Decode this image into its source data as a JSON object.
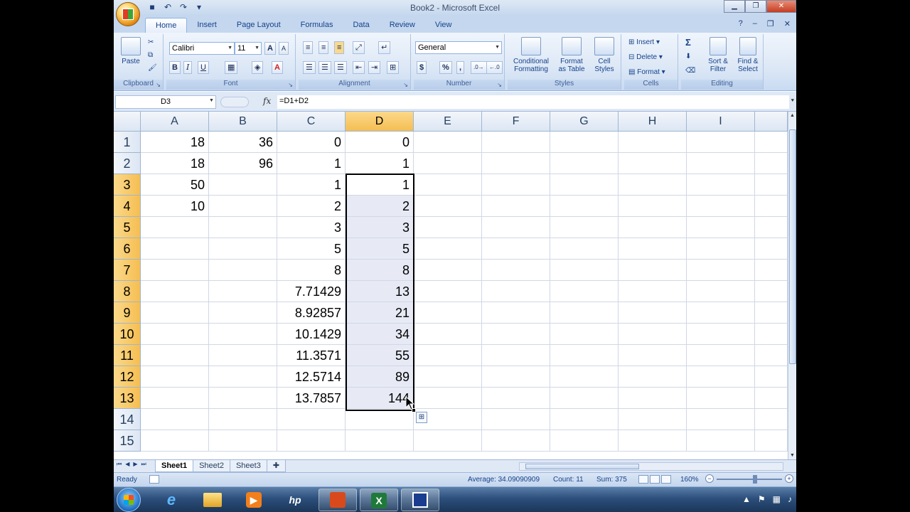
{
  "window": {
    "title": "Book2 - Microsoft Excel"
  },
  "tabs": [
    "Home",
    "Insert",
    "Page Layout",
    "Formulas",
    "Data",
    "Review",
    "View"
  ],
  "ribbon": {
    "clipboard": {
      "paste": "Paste",
      "label": "Clipboard"
    },
    "font": {
      "name": "Calibri",
      "size": "11",
      "grow": "A",
      "shrink": "A",
      "bold": "B",
      "italic": "I",
      "underline": "U",
      "label": "Font"
    },
    "alignment": {
      "label": "Alignment"
    },
    "number": {
      "format": "General",
      "currency": "$",
      "percent": "%",
      "comma": ",",
      "label": "Number"
    },
    "styles": {
      "conditional": "Conditional",
      "conditional2": "Formatting",
      "format_table": "Format",
      "format_table2": "as Table",
      "cell_styles": "Cell",
      "cell_styles2": "Styles",
      "label": "Styles"
    },
    "cells": {
      "insert": "Insert",
      "delete": "Delete",
      "format": "Format",
      "label": "Cells"
    },
    "editing": {
      "sigma": "Σ",
      "sort": "Sort &",
      "sort2": "Filter",
      "find": "Find &",
      "find2": "Select",
      "label": "Editing"
    }
  },
  "formula_bar": {
    "name_box": "D3",
    "fx": "fx",
    "formula": "=D1+D2"
  },
  "columns": [
    "A",
    "B",
    "C",
    "D",
    "E",
    "F",
    "G",
    "H",
    "I"
  ],
  "rows": [
    {
      "n": "1",
      "a": "18",
      "b": "36",
      "c": "0",
      "d": "0"
    },
    {
      "n": "2",
      "a": "18",
      "b": "96",
      "c": "1",
      "d": "1"
    },
    {
      "n": "3",
      "a": "50",
      "b": "",
      "c": "1",
      "d": "1"
    },
    {
      "n": "4",
      "a": "10",
      "b": "",
      "c": "2",
      "d": "2"
    },
    {
      "n": "5",
      "a": "",
      "b": "",
      "c": "3",
      "d": "3"
    },
    {
      "n": "6",
      "a": "",
      "b": "",
      "c": "5",
      "d": "5"
    },
    {
      "n": "7",
      "a": "",
      "b": "",
      "c": "8",
      "d": "8"
    },
    {
      "n": "8",
      "a": "",
      "b": "",
      "c": "7.71429",
      "d": "13"
    },
    {
      "n": "9",
      "a": "",
      "b": "",
      "c": "8.92857",
      "d": "21"
    },
    {
      "n": "10",
      "a": "",
      "b": "",
      "c": "10.1429",
      "d": "34"
    },
    {
      "n": "11",
      "a": "",
      "b": "",
      "c": "11.3571",
      "d": "55"
    },
    {
      "n": "12",
      "a": "",
      "b": "",
      "c": "12.5714",
      "d": "89"
    },
    {
      "n": "13",
      "a": "",
      "b": "",
      "c": "13.7857",
      "d": "144"
    },
    {
      "n": "14",
      "a": "",
      "b": "",
      "c": "",
      "d": ""
    },
    {
      "n": "15",
      "a": "",
      "b": "",
      "c": "",
      "d": ""
    }
  ],
  "sheets": [
    "Sheet1",
    "Sheet2",
    "Sheet3"
  ],
  "status": {
    "ready": "Ready",
    "average": "Average: 34.09090909",
    "count": "Count: 11",
    "sum": "Sum: 375",
    "zoom": "160%"
  },
  "taskbar_apps": [
    "ie-icon",
    "explorer-icon",
    "media-player-icon",
    "hp-icon",
    "office-icon",
    "excel-icon",
    "screen-recorder-icon"
  ]
}
